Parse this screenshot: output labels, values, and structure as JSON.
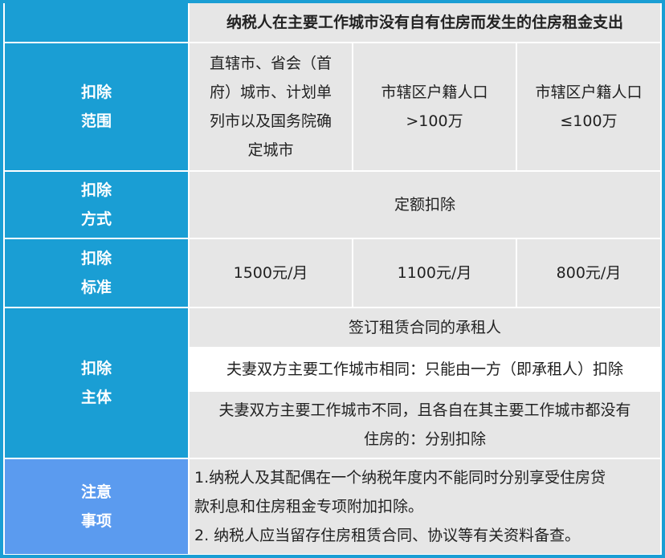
{
  "header": {
    "title": "纳税人在主要工作城市没有自有住房而发生的住房租金支出"
  },
  "rows": {
    "scope": {
      "label": [
        "扣除",
        "范围"
      ],
      "cells": [
        [
          "直辖市、省会（首",
          "府）城市、计划单",
          "列市以及国务院确",
          "定城市"
        ],
        [
          "市辖区户籍人口",
          ">100万"
        ],
        [
          "市辖区户籍人口",
          "≤100万"
        ]
      ]
    },
    "method": {
      "label": [
        "扣除",
        "方式"
      ],
      "value": "定额扣除"
    },
    "standard": {
      "label": [
        "扣除",
        "标准"
      ],
      "values": [
        "1500元/月",
        "1100元/月",
        "800元/月"
      ]
    },
    "subject": {
      "label": [
        "扣除",
        "主体"
      ],
      "lines": [
        "签订租赁合同的承租人",
        "夫妻双方主要工作城市相同：只能由一方（即承租人）扣除",
        [
          "夫妻双方主要工作城市不同，且各自在其主要工作城市都没有",
          "住房的：分别扣除"
        ]
      ]
    },
    "notes": {
      "label": [
        "注意",
        "事项"
      ],
      "items": [
        [
          "1.纳税人及其配偶在一个纳税年度内不能同时分别享受住房贷",
          "款利息和住房租金专项附加扣除。"
        ],
        "2. 纳税人应当留存住房租赁合同、协议等有关资料备查。"
      ]
    }
  },
  "colors": {
    "header_blue": "#1a9ed4",
    "notes_blue": "#5b9bef",
    "cell_gray": "#e6e6e6",
    "grid_white": "#ffffff"
  }
}
